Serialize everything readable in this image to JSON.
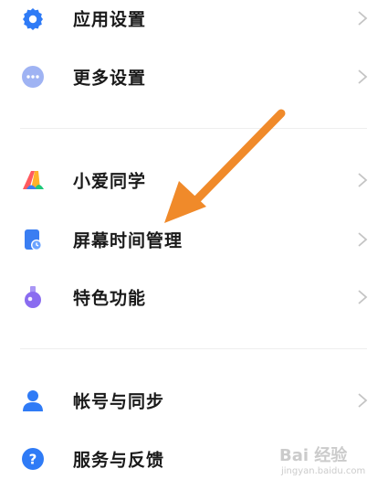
{
  "menu": {
    "items": [
      {
        "label": "应用设置",
        "icon": "gear-icon",
        "color": "#2f7bf6"
      },
      {
        "label": "更多设置",
        "icon": "more-dots-icon",
        "color": "#8da4f0"
      },
      {
        "label": "小爱同学",
        "icon": "xiaoai-icon",
        "color": "#ff5a5f"
      },
      {
        "label": "屏幕时间管理",
        "icon": "screen-time-icon",
        "color": "#3a7ef2"
      },
      {
        "label": "特色功能",
        "icon": "flask-icon",
        "color": "#8a6cf0"
      },
      {
        "label": "帐号与同步",
        "icon": "person-icon",
        "color": "#2f7bf6"
      },
      {
        "label": "服务与反馈",
        "icon": "help-icon",
        "color": "#2f7bf6"
      }
    ]
  },
  "annotation": {
    "color": "#f08a2a"
  },
  "watermark": {
    "text": "Bai 经验",
    "sub": "jingyan.baidu.com"
  }
}
